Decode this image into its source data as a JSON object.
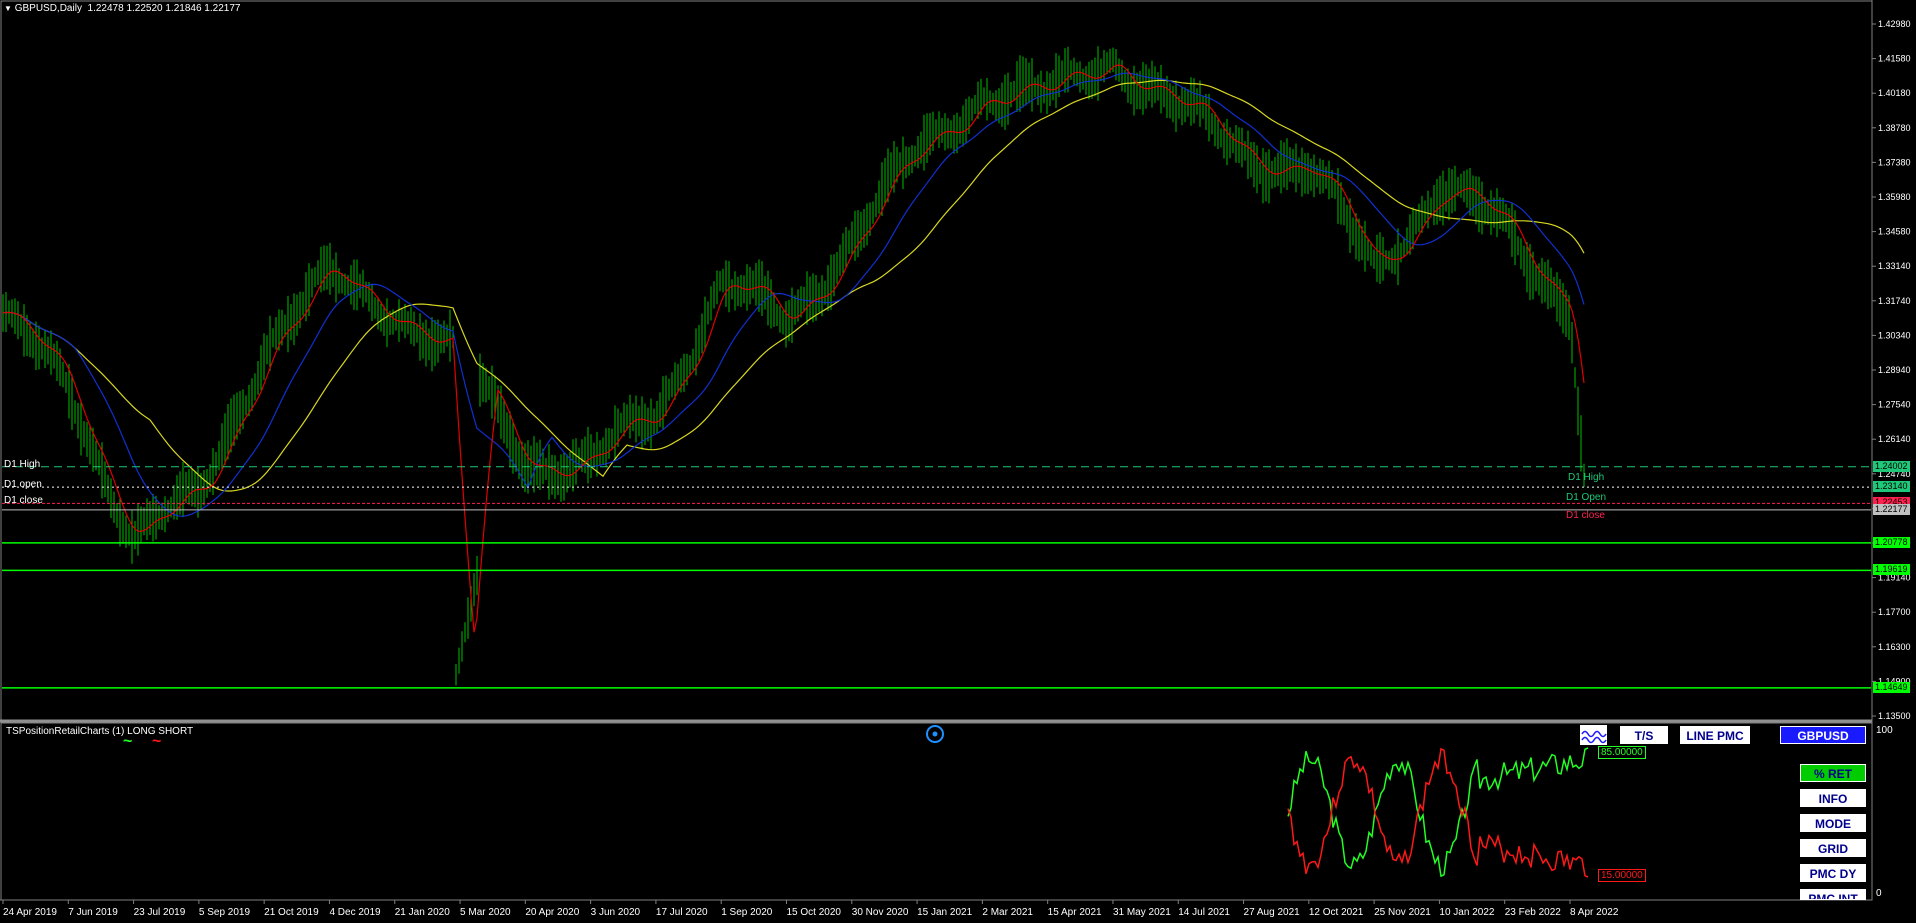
{
  "header": {
    "symbol_line": "GBPUSD,Daily",
    "ohlc": "1.22478 1.22520 1.21846 1.22177"
  },
  "colors": {
    "candle": "#00c000",
    "ma_red": "#e00000",
    "ma_blue": "#1030d0",
    "ma_yellow": "#d8d820",
    "level": "#00ff00",
    "d1": "#1ec878",
    "close": "#ff2050"
  },
  "price_axis": [
    "1.42980",
    "1.41580",
    "1.40180",
    "1.38780",
    "1.37380",
    "1.35980",
    "1.34580",
    "1.33140",
    "1.31740",
    "1.30340",
    "1.28940",
    "1.27540",
    "1.26140",
    "1.24740",
    "1.21940",
    "1.20540",
    "1.19140",
    "1.17700",
    "1.16300",
    "1.14900",
    "1.13500"
  ],
  "price_tags": [
    {
      "value": "1.24002",
      "bg": "#1ec878"
    },
    {
      "value": "1.23140",
      "bg": "#1ec878"
    },
    {
      "value": "1.22453",
      "bg": "#ff2050"
    },
    {
      "value": "1.22177",
      "bg": "#c0c0c0"
    },
    {
      "value": "1.20778",
      "bg": "#00ff00"
    },
    {
      "value": "1.19619",
      "bg": "#00ff00"
    },
    {
      "value": "1.14649",
      "bg": "#00ff00"
    }
  ],
  "d1_labels_left": {
    "high": "D1 High",
    "open": "D1 open",
    "close": "D1 close"
  },
  "d1_labels_right": {
    "high": "D1 High",
    "open": "D1 Open",
    "close": "D1 close"
  },
  "date_axis": [
    "24 Apr 2019",
    "7 Jun 2019",
    "23 Jul 2019",
    "5 Sep 2019",
    "21 Oct 2019",
    "4 Dec 2019",
    "21 Jan 2020",
    "5 Mar 2020",
    "20 Apr 2020",
    "3 Jun 2020",
    "17 Jul 2020",
    "1 Sep 2020",
    "15 Oct 2020",
    "30 Nov 2020",
    "15 Jan 2021",
    "2 Mar 2021",
    "15 Apr 2021",
    "31 May 2021",
    "14 Jul 2021",
    "27 Aug 2021",
    "12 Oct 2021",
    "25 Nov 2021",
    "10 Jan 2022",
    "23 Feb 2022",
    "8 Apr 2022"
  ],
  "indicator": {
    "title": "TSPositionRetailCharts (1) LONG SHORT",
    "scale_top": "100",
    "scale_bottom": "0",
    "long_value": "85.00000",
    "short_value": "15.00000"
  },
  "buttons": {
    "ts": "T/S",
    "line_pmc": "LINE PMC",
    "symbol": "GBPUSD",
    "ret": "% RET",
    "info": "INFO",
    "mode": "MODE",
    "grid": "GRID",
    "pmc_dy": "PMC DY",
    "pmc_int": "PMC INT"
  },
  "chart_data": {
    "type": "line",
    "title": "GBPUSD,Daily",
    "ylim": [
      1.135,
      1.4298
    ],
    "x": [
      "24 Apr 2019",
      "7 Jun 2019",
      "23 Jul 2019",
      "5 Sep 2019",
      "21 Oct 2019",
      "4 Dec 2019",
      "21 Jan 2020",
      "5 Mar 2020",
      "20 Apr 2020",
      "3 Jun 2020",
      "17 Jul 2020",
      "1 Sep 2020",
      "15 Oct 2020",
      "30 Nov 2020",
      "15 Jan 2021",
      "2 Mar 2021",
      "15 Apr 2021",
      "31 May 2021",
      "14 Jul 2021",
      "27 Aug 2021",
      "12 Oct 2021",
      "25 Nov 2021",
      "10 Jan 2022",
      "23 Feb 2022",
      "8 Apr 2022"
    ],
    "series": [
      {
        "values": [
          1.303,
          1.273,
          1.212,
          1.225,
          1.292,
          1.318,
          1.308,
          1.285,
          1.245,
          1.24,
          1.263,
          1.318,
          1.3,
          1.338,
          1.37,
          1.4,
          1.395,
          1.415,
          1.39,
          1.375,
          1.365,
          1.325,
          1.358,
          1.34,
          1.31
        ]
      }
    ],
    "levels": [
      1.24002,
      1.2314,
      1.22453,
      1.22177,
      1.20778,
      1.19619,
      1.14649
    ]
  }
}
